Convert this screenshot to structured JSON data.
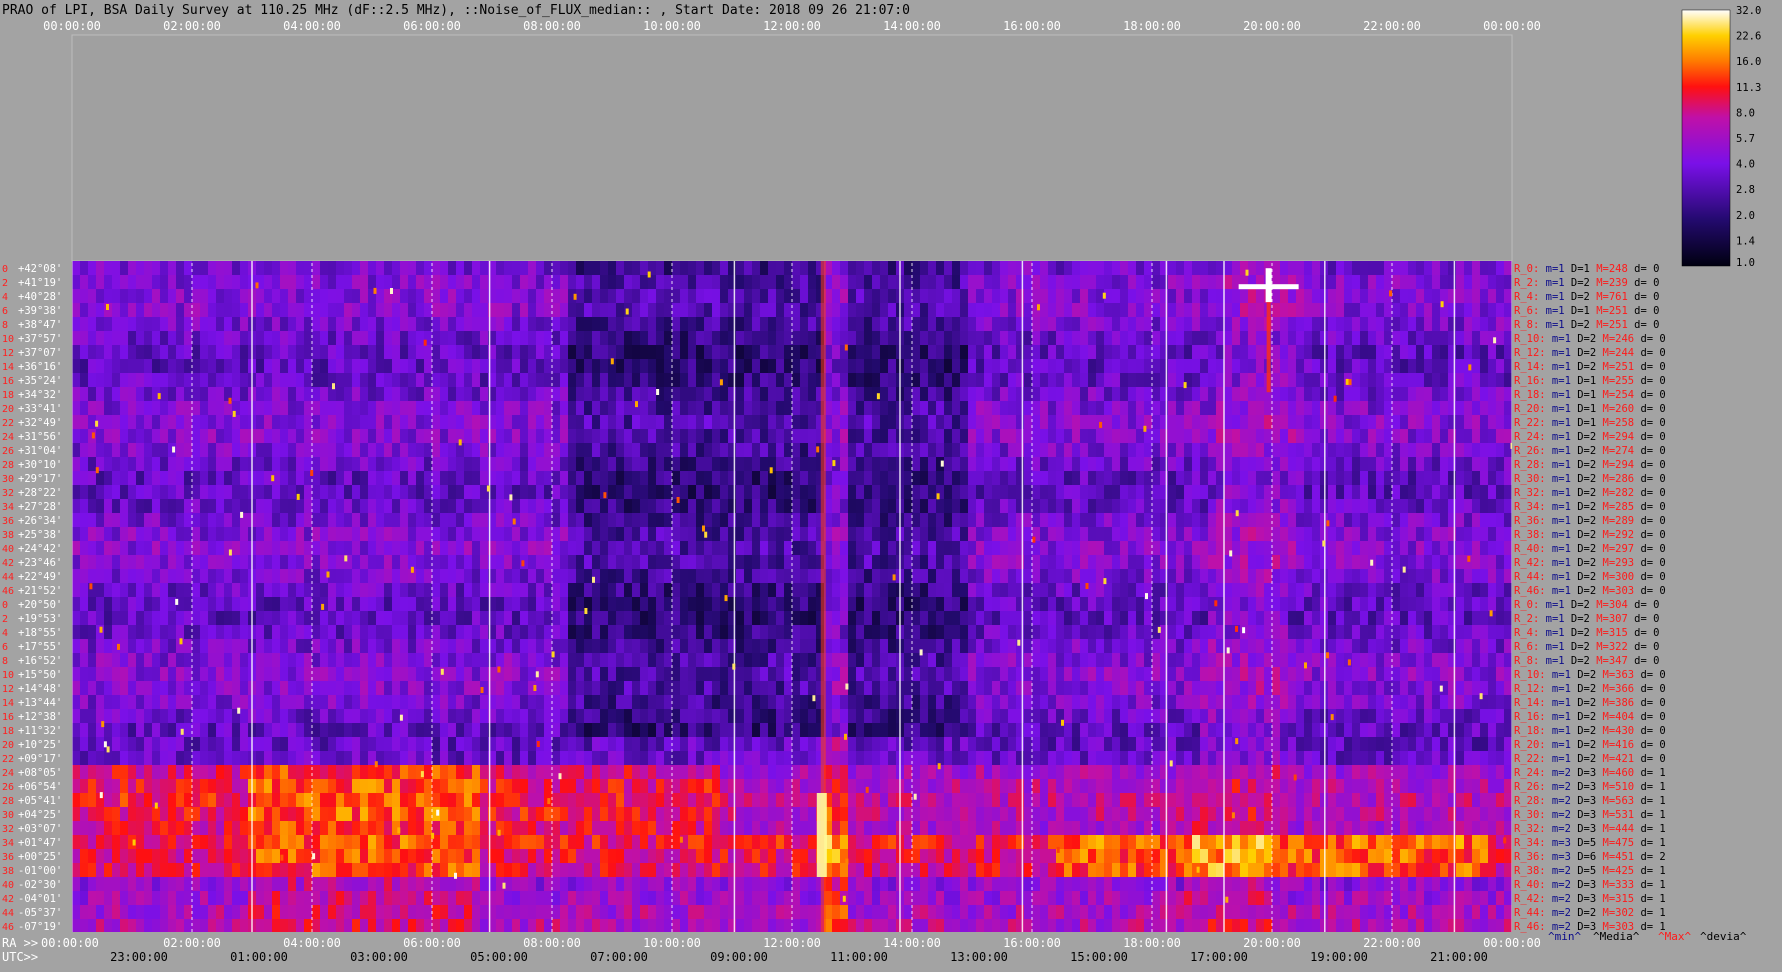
{
  "chart_data": {
    "type": "heatmap",
    "title": "PRAO of LPI, BSA Daily Survey at 110.25 MHz (dF::2.5 MHz), ::Noise_of_FLUX_median:: , Start Date: 2018 09 26 21:07:0",
    "top_ticks": [
      "00:00:00",
      "02:00:00",
      "04:00:00",
      "06:00:00",
      "08:00:00",
      "10:00:00",
      "12:00:00",
      "14:00:00",
      "16:00:00",
      "18:00:00",
      "20:00:00",
      "22:00:00",
      "00:00:00"
    ],
    "ra_label": "RA >>",
    "ra_ticks": [
      "00:00:00",
      "02:00:00",
      "04:00:00",
      "06:00:00",
      "08:00:00",
      "10:00:00",
      "12:00:00",
      "14:00:00",
      "16:00:00",
      "18:00:00",
      "20:00:00",
      "22:00:00",
      "00:00:00"
    ],
    "utc_label": "UTC>>",
    "utc_ticks": [
      "23:00:00",
      "01:00:00",
      "03:00:00",
      "05:00:00",
      "07:00:00",
      "09:00:00",
      "11:00:00",
      "13:00:00",
      "15:00:00",
      "17:00:00",
      "19:00:00",
      "21:00:00"
    ],
    "row_indices": [
      "0",
      "2",
      "4",
      "6",
      "8",
      "10",
      "12",
      "14",
      "16",
      "18",
      "20",
      "22",
      "24",
      "26",
      "28",
      "30",
      "32",
      "34",
      "36",
      "38",
      "40",
      "42",
      "44",
      "46",
      "0",
      "2",
      "4",
      "6",
      "8",
      "10",
      "12",
      "14",
      "16",
      "18",
      "20",
      "22",
      "24",
      "26",
      "28",
      "30",
      "32",
      "34",
      "36",
      "38",
      "40",
      "42",
      "44",
      "46"
    ],
    "declinations": [
      "+42°08'",
      "+41°19'",
      "+40°28'",
      "+39°38'",
      "+38°47'",
      "+37°57'",
      "+37°07'",
      "+36°16'",
      "+35°24'",
      "+34°32'",
      "+33°41'",
      "+32°49'",
      "+31°56'",
      "+31°04'",
      "+30°10'",
      "+29°17'",
      "+28°22'",
      "+27°28'",
      "+26°34'",
      "+25°38'",
      "+24°42'",
      "+23°46'",
      "+22°49'",
      "+21°52'",
      "+20°50'",
      "+19°53'",
      "+18°55'",
      "+17°55'",
      "+16°52'",
      "+15°50'",
      "+14°48'",
      "+13°44'",
      "+12°38'",
      "+11°32'",
      "+10°25'",
      "+09°17'",
      "+08°05'",
      "+06°54'",
      "+05°41'",
      "+04°25'",
      "+03°07'",
      "+01°47'",
      "+00°25'",
      "-01°00'",
      "-02°30'",
      "-04°01'",
      "-05°37'",
      "-07°19'"
    ],
    "row_stats": [
      {
        "r": "R_0:",
        "m": "m=1",
        "D": "D=1",
        "M": "M=248",
        "d": "d= 0"
      },
      {
        "r": "R_2:",
        "m": "m=1",
        "D": "D=2",
        "M": "M=239",
        "d": "d= 0"
      },
      {
        "r": "R_4:",
        "m": "m=1",
        "D": "D=2",
        "M": "M=761",
        "d": "d= 0"
      },
      {
        "r": "R_6:",
        "m": "m=1",
        "D": "D=1",
        "M": "M=251",
        "d": "d= 0"
      },
      {
        "r": "R_8:",
        "m": "m=1",
        "D": "D=2",
        "M": "M=251",
        "d": "d= 0"
      },
      {
        "r": "R_10:",
        "m": "m=1",
        "D": "D=2",
        "M": "M=246",
        "d": "d= 0"
      },
      {
        "r": "R_12:",
        "m": "m=1",
        "D": "D=2",
        "M": "M=244",
        "d": "d= 0"
      },
      {
        "r": "R_14:",
        "m": "m=1",
        "D": "D=2",
        "M": "M=251",
        "d": "d= 0"
      },
      {
        "r": "R_16:",
        "m": "m=1",
        "D": "D=1",
        "M": "M=255",
        "d": "d= 0"
      },
      {
        "r": "R_18:",
        "m": "m=1",
        "D": "D=1",
        "M": "M=254",
        "d": "d= 0"
      },
      {
        "r": "R_20:",
        "m": "m=1",
        "D": "D=1",
        "M": "M=260",
        "d": "d= 0"
      },
      {
        "r": "R_22:",
        "m": "m=1",
        "D": "D=1",
        "M": "M=258",
        "d": "d= 0"
      },
      {
        "r": "R_24:",
        "m": "m=1",
        "D": "D=2",
        "M": "M=294",
        "d": "d= 0"
      },
      {
        "r": "R_26:",
        "m": "m=1",
        "D": "D=2",
        "M": "M=274",
        "d": "d= 0"
      },
      {
        "r": "R_28:",
        "m": "m=1",
        "D": "D=2",
        "M": "M=294",
        "d": "d= 0"
      },
      {
        "r": "R_30:",
        "m": "m=1",
        "D": "D=2",
        "M": "M=286",
        "d": "d= 0"
      },
      {
        "r": "R_32:",
        "m": "m=1",
        "D": "D=2",
        "M": "M=282",
        "d": "d= 0"
      },
      {
        "r": "R_34:",
        "m": "m=1",
        "D": "D=2",
        "M": "M=285",
        "d": "d= 0"
      },
      {
        "r": "R_36:",
        "m": "m=1",
        "D": "D=2",
        "M": "M=289",
        "d": "d= 0"
      },
      {
        "r": "R_38:",
        "m": "m=1",
        "D": "D=2",
        "M": "M=292",
        "d": "d= 0"
      },
      {
        "r": "R_40:",
        "m": "m=1",
        "D": "D=2",
        "M": "M=297",
        "d": "d= 0"
      },
      {
        "r": "R_42:",
        "m": "m=1",
        "D": "D=2",
        "M": "M=293",
        "d": "d= 0"
      },
      {
        "r": "R_44:",
        "m": "m=1",
        "D": "D=2",
        "M": "M=300",
        "d": "d= 0"
      },
      {
        "r": "R_46:",
        "m": "m=1",
        "D": "D=2",
        "M": "M=303",
        "d": "d= 0"
      },
      {
        "r": "R_0:",
        "m": "m=1",
        "D": "D=2",
        "M": "M=304",
        "d": "d= 0"
      },
      {
        "r": "R_2:",
        "m": "m=1",
        "D": "D=2",
        "M": "M=307",
        "d": "d= 0"
      },
      {
        "r": "R_4:",
        "m": "m=1",
        "D": "D=2",
        "M": "M=315",
        "d": "d= 0"
      },
      {
        "r": "R_6:",
        "m": "m=1",
        "D": "D=2",
        "M": "M=322",
        "d": "d= 0"
      },
      {
        "r": "R_8:",
        "m": "m=1",
        "D": "D=2",
        "M": "M=347",
        "d": "d= 0"
      },
      {
        "r": "R_10:",
        "m": "m=1",
        "D": "D=2",
        "M": "M=363",
        "d": "d= 0"
      },
      {
        "r": "R_12:",
        "m": "m=1",
        "D": "D=2",
        "M": "M=366",
        "d": "d= 0"
      },
      {
        "r": "R_14:",
        "m": "m=1",
        "D": "D=2",
        "M": "M=386",
        "d": "d= 0"
      },
      {
        "r": "R_16:",
        "m": "m=1",
        "D": "D=2",
        "M": "M=404",
        "d": "d= 0"
      },
      {
        "r": "R_18:",
        "m": "m=1",
        "D": "D=2",
        "M": "M=430",
        "d": "d= 0"
      },
      {
        "r": "R_20:",
        "m": "m=1",
        "D": "D=2",
        "M": "M=416",
        "d": "d= 0"
      },
      {
        "r": "R_22:",
        "m": "m=1",
        "D": "D=2",
        "M": "M=421",
        "d": "d= 0"
      },
      {
        "r": "R_24:",
        "m": "m=2",
        "D": "D=3",
        "M": "M=460",
        "d": "d= 1"
      },
      {
        "r": "R_26:",
        "m": "m=2",
        "D": "D=3",
        "M": "M=510",
        "d": "d= 1"
      },
      {
        "r": "R_28:",
        "m": "m=2",
        "D": "D=3",
        "M": "M=563",
        "d": "d= 1"
      },
      {
        "r": "R_30:",
        "m": "m=2",
        "D": "D=3",
        "M": "M=531",
        "d": "d= 1"
      },
      {
        "r": "R_32:",
        "m": "m=2",
        "D": "D=3",
        "M": "M=444",
        "d": "d= 1"
      },
      {
        "r": "R_34:",
        "m": "m=3",
        "D": "D=5",
        "M": "M=475",
        "d": "d= 1"
      },
      {
        "r": "R_36:",
        "m": "m=3",
        "D": "D=6",
        "M": "M=451",
        "d": "d= 2"
      },
      {
        "r": "R_38:",
        "m": "m=2",
        "D": "D=5",
        "M": "M=425",
        "d": "d= 1"
      },
      {
        "r": "R_40:",
        "m": "m=2",
        "D": "D=3",
        "M": "M=333",
        "d": "d= 1"
      },
      {
        "r": "R_42:",
        "m": "m=2",
        "D": "D=3",
        "M": "M=315",
        "d": "d= 1"
      },
      {
        "r": "R_44:",
        "m": "m=2",
        "D": "D=2",
        "M": "M=302",
        "d": "d= 1"
      },
      {
        "r": "R_46:",
        "m": "m=2",
        "D": "D=3",
        "M": "M=303",
        "d": "d= 1"
      }
    ],
    "stat_legend": {
      "min": "^min^",
      "median": "^Media^",
      "max": "^Max^",
      "devia": "^devia^"
    },
    "colorbar": {
      "ticks": [
        "32.0",
        "22.6",
        "16.0",
        "11.3",
        "8.0",
        "5.7",
        "4.0",
        "2.8",
        "2.0",
        "1.4",
        "1.0"
      ],
      "range": [
        1.0,
        32.0
      ],
      "scale": "log"
    },
    "colors": {
      "background": "#a3a3a3",
      "title_text": "#000000",
      "top_tick_text": "#ffffff",
      "row_index_text": "#ff2020",
      "declination_text": "#ffffff",
      "stat_r": "#ff1a1a",
      "stat_m": "#0b0b8a",
      "stat_D": "#000000",
      "stat_M": "#ff1a1a",
      "stat_d": "#000000"
    }
  }
}
